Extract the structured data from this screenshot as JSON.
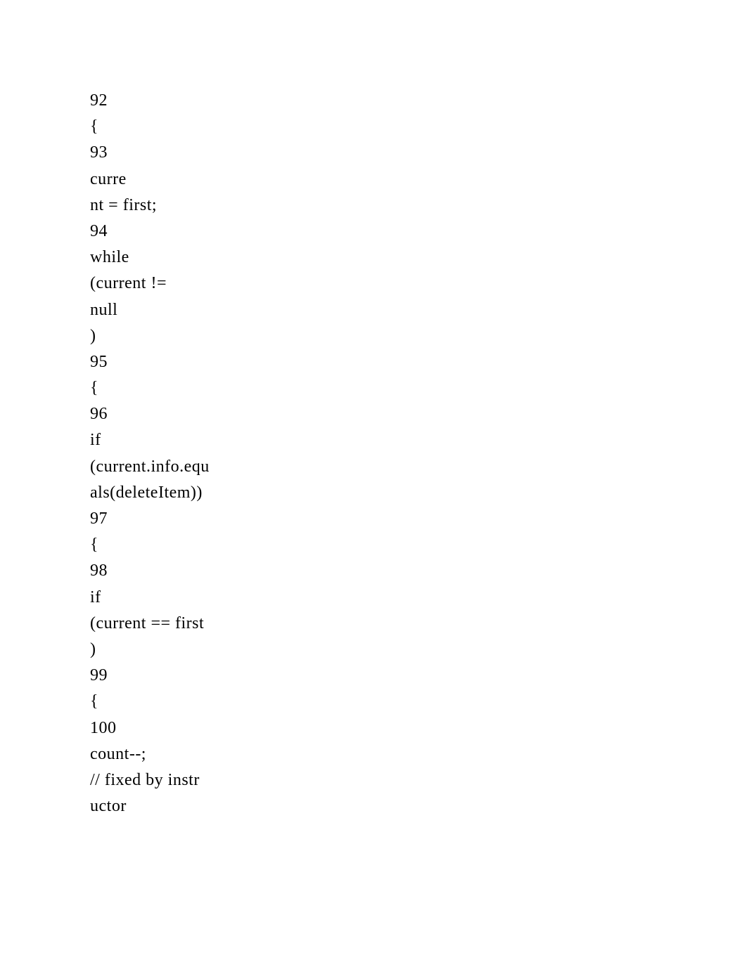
{
  "lines": [
    "92",
    "{",
    "93",
    "curre",
    "nt = first;",
    "94",
    "while",
    "(current !=",
    "null",
    ")",
    "95",
    "{",
    "96",
    "if",
    "(current.info.equ",
    "als(deleteItem))",
    "97",
    "{",
    "98",
    "if",
    "(current == first",
    ")",
    "99",
    "{",
    "100",
    "count--;",
    "// fixed by instr",
    "uctor"
  ]
}
